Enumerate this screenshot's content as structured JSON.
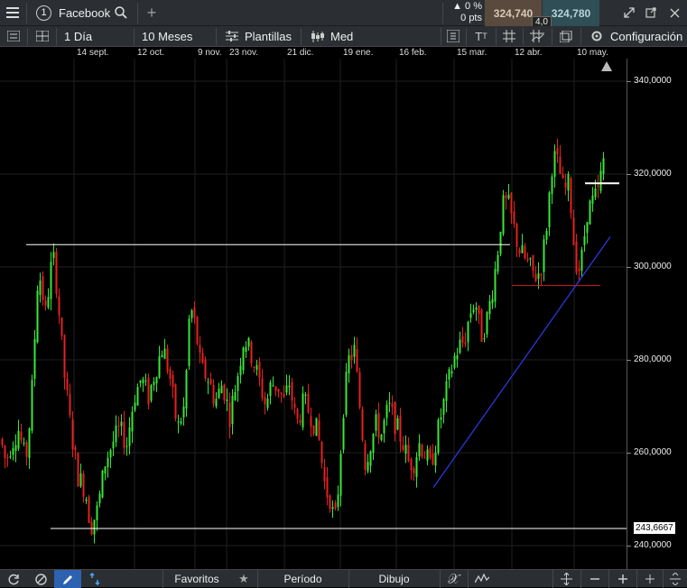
{
  "topbar": {
    "instrument_number": "1",
    "instrument_name": "Facebook",
    "change_percent": "▲ 0 %",
    "change_pts": "0 pts",
    "sell_price": "324,740",
    "buy_price": "324,780",
    "spread": "4,0"
  },
  "toolbar": {
    "interval": "1 Día",
    "range": "10 Meses",
    "templates": "Plantillas",
    "chart_style": "Med",
    "settings": "Configuración"
  },
  "bottombar": {
    "favorites": "Favoritos",
    "period": "Período",
    "drawing": "Dibujo"
  },
  "chart_data": {
    "type": "candlestick",
    "x_tick_labels": [
      "14 sept.",
      "12 oct.",
      "9 nov.",
      "23 nov.",
      "21 dic.",
      "19 ene.",
      "16 feb.",
      "15 mar.",
      "12 abr.",
      "10 may."
    ],
    "y_tick_labels": [
      "340,0000",
      "320,0000",
      "300,0000",
      "280,0000",
      "260,0000",
      "240,0000"
    ],
    "ylim": [
      240,
      343
    ],
    "price_marker": "243,6667",
    "colors": {
      "up": "#39e639",
      "down": "#e62020",
      "grid": "#1f1f1f",
      "trend": "#2b3be8",
      "support": "#cc2222"
    },
    "lines": [
      {
        "type": "horizontal",
        "y": 304.8,
        "color": "#ffffff"
      },
      {
        "type": "horizontal",
        "y": 243.7,
        "color": "#ffffff"
      },
      {
        "type": "horizontal",
        "y": 296.0,
        "color": "#cc2222"
      },
      {
        "type": "horizontal",
        "y": 318.0,
        "color": "#ffffff"
      },
      {
        "type": "trendline",
        "y_start": 252.5,
        "y_end": 306.5,
        "color": "#2b3be8"
      }
    ]
  }
}
